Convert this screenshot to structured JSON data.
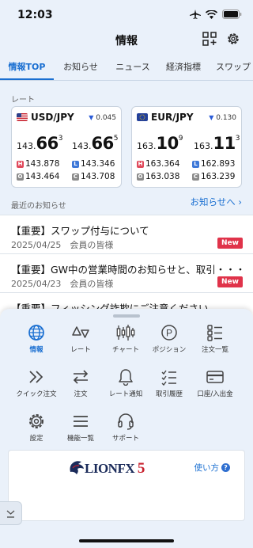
{
  "status": {
    "time": "12:03"
  },
  "nav": {
    "title": "情報"
  },
  "tabs": [
    {
      "label": "情報TOP",
      "active": true
    },
    {
      "label": "お知らせ",
      "active": false
    },
    {
      "label": "ニュース",
      "active": false
    },
    {
      "label": "経済指標",
      "active": false
    },
    {
      "label": "スワップ",
      "active": false
    }
  ],
  "rates": {
    "label": "レート",
    "cards": [
      {
        "pair": "USD/JPY",
        "change": "0.045",
        "bid": {
          "prefix": "143.",
          "big": "66",
          "sup": "3"
        },
        "ask": {
          "prefix": "143.",
          "big": "66",
          "sup": "5"
        },
        "high": "143.878",
        "low": "143.346",
        "open": "143.464",
        "close": "143.708"
      },
      {
        "pair": "EUR/JPY",
        "change": "0.130",
        "bid": {
          "prefix": "163.",
          "big": "10",
          "sup": "9"
        },
        "ask": {
          "prefix": "163.",
          "big": "11",
          "sup": "3"
        },
        "high": "163.364",
        "low": "162.893",
        "open": "163.038",
        "close": "163.239"
      }
    ],
    "badges": {
      "high": "H",
      "low": "L",
      "open": "O",
      "close": "C"
    }
  },
  "news": {
    "label": "最近のお知らせ",
    "link": "お知らせへ",
    "items": [
      {
        "title": "【重要】スワップ付与について",
        "date": "2025/04/25",
        "audience": "会員の皆様",
        "badge": "New"
      },
      {
        "title": "【重要】GW中の営業時間のお知らせと、取引・・・",
        "date": "2025/04/23",
        "audience": "会員の皆様",
        "badge": "New"
      },
      {
        "title": "【重要】フィッシング詐欺にご注意ください",
        "date": "",
        "audience": "",
        "badge": ""
      }
    ]
  },
  "menu": {
    "items": [
      {
        "label": "情報",
        "icon": "globe-icon",
        "active": true
      },
      {
        "label": "レート",
        "icon": "rate-icon",
        "active": false
      },
      {
        "label": "チャート",
        "icon": "candlestick-icon",
        "active": false
      },
      {
        "label": "ポジション",
        "icon": "position-icon",
        "active": false
      },
      {
        "label": "注文一覧",
        "icon": "order-list-icon",
        "active": false
      },
      {
        "label": "クイック注文",
        "icon": "quick-order-icon",
        "active": false
      },
      {
        "label": "注文",
        "icon": "order-icon",
        "active": false
      },
      {
        "label": "レート通知",
        "icon": "bell-icon",
        "active": false
      },
      {
        "label": "取引履歴",
        "icon": "history-icon",
        "active": false
      },
      {
        "label": "口座/入出金",
        "icon": "card-icon",
        "active": false
      },
      {
        "label": "設定",
        "icon": "gear-icon",
        "active": false
      },
      {
        "label": "機能一覧",
        "icon": "menu-icon",
        "active": false
      },
      {
        "label": "サポート",
        "icon": "headset-icon",
        "active": false
      }
    ]
  },
  "banner": {
    "brand": "LIONFX",
    "brand_num": "5",
    "howto": "使い方",
    "howto_icon": "?"
  },
  "colors": {
    "accent": "#1a6fd1",
    "new_badge": "#e0334a",
    "high": "#e04a5c",
    "low": "#3d78d8"
  }
}
